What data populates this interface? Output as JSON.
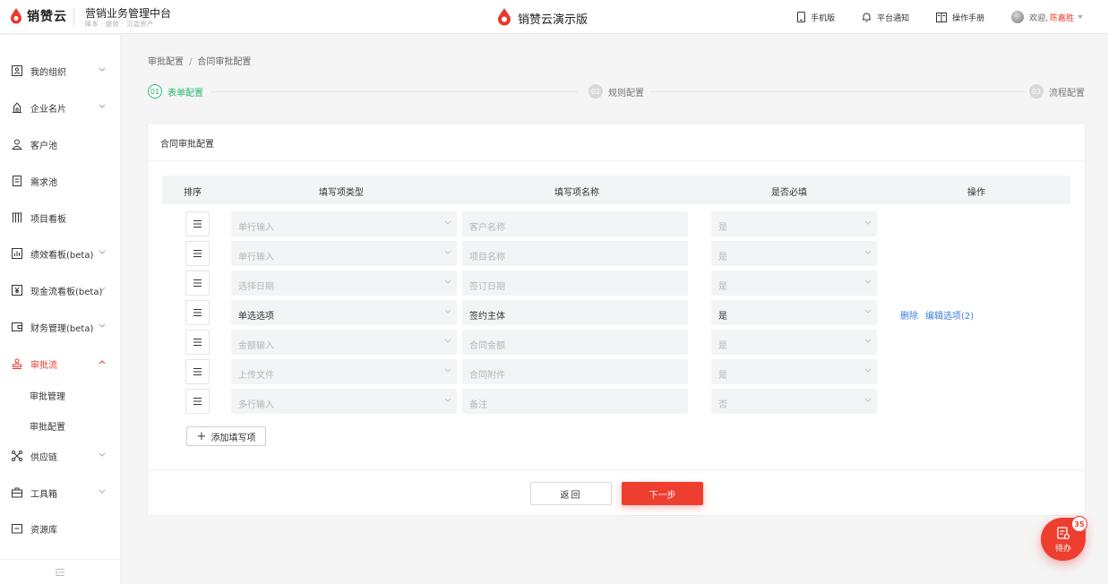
{
  "header": {
    "logo_text": "销赞云",
    "system_title": "营销业务管理中台",
    "system_subtitle": "降本 · 提效 · 沉淀资产",
    "center_title": "销赞云演示版",
    "mobile_label": "手机版",
    "notice_label": "平台通知",
    "manual_label": "操作手册",
    "welcome": "欢迎,",
    "user_name": "陈嘉胜"
  },
  "sidebar": {
    "items": [
      {
        "label": "我的组织",
        "icon": "org-icon"
      },
      {
        "label": "企业名片",
        "icon": "building-icon"
      },
      {
        "label": "客户池",
        "icon": "person-icon"
      },
      {
        "label": "需求池",
        "icon": "doc-icon"
      },
      {
        "label": "项目看板",
        "icon": "columns-icon"
      },
      {
        "label": "绩效看板(beta)",
        "icon": "chart-icon"
      },
      {
        "label": "现金流看板(beta)",
        "icon": "yuan-icon"
      },
      {
        "label": "财务管理(beta)",
        "icon": "wallet-icon"
      },
      {
        "label": "审批流",
        "icon": "stamp-icon"
      },
      {
        "label": "供应链",
        "icon": "network-icon"
      },
      {
        "label": "工具箱",
        "icon": "toolbox-icon"
      },
      {
        "label": "资源库",
        "icon": "folder-icon"
      }
    ],
    "sub_items": [
      {
        "label": "审批管理"
      },
      {
        "label": "审批配置"
      }
    ]
  },
  "breadcrumb": {
    "parent": "审批配置",
    "separator": "/",
    "current": "合同审批配置"
  },
  "steps": [
    {
      "num": "01",
      "label": "表单配置",
      "state": "active"
    },
    {
      "num": "02",
      "label": "规则配置",
      "state": "pending"
    },
    {
      "num": "03",
      "label": "流程配置",
      "state": "pending"
    }
  ],
  "card": {
    "title": "合同审批配置",
    "columns": [
      "排序",
      "填写项类型",
      "填写项名称",
      "是否必填",
      "操作"
    ],
    "rows": [
      {
        "type": "单行输入",
        "name": "客户名称",
        "required": "是"
      },
      {
        "type": "单行输入",
        "name": "项目名称",
        "required": "是"
      },
      {
        "type": "选择日期",
        "name": "签订日期",
        "required": "是"
      },
      {
        "type": "单选选项",
        "name": "签约主体",
        "required": "是",
        "op_delete": "删除",
        "op_edit": "编辑选项(2)"
      },
      {
        "type": "金额输入",
        "name": "合同金额",
        "required": "是"
      },
      {
        "type": "上传文件",
        "name": "合同附件",
        "required": "是"
      },
      {
        "type": "多行输入",
        "name": "备注",
        "required": "否"
      }
    ],
    "add_button": "添加填写项",
    "back_button": "返回",
    "next_button": "下一步"
  },
  "todo": {
    "label": "待办",
    "count": "35"
  },
  "colors": {
    "brand_red": "#ee3e2f",
    "step_green": "#28b76b",
    "link_blue": "#3a7fd6"
  }
}
